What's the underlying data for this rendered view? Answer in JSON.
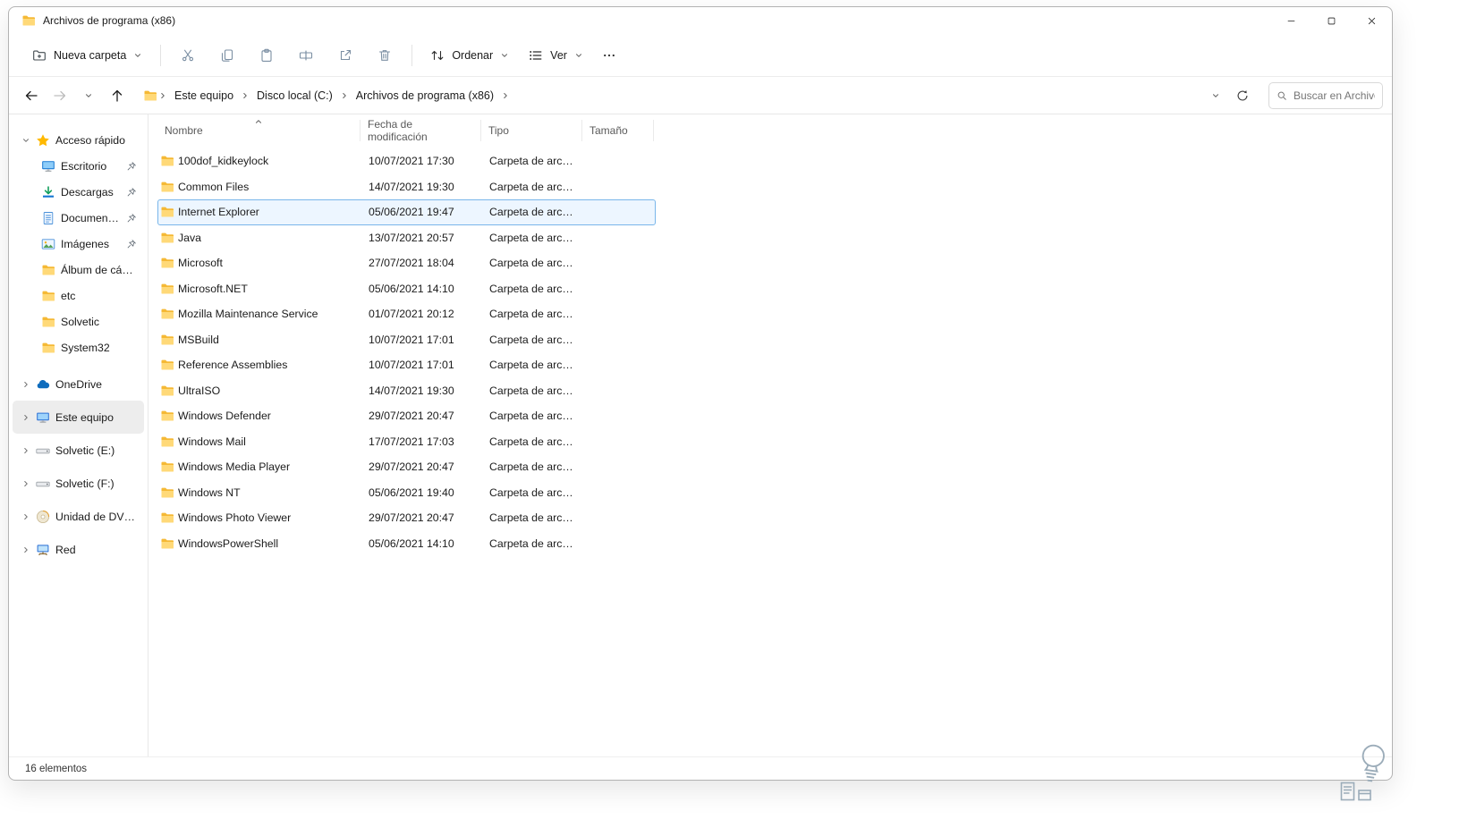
{
  "window": {
    "title": "Archivos de programa (x86)"
  },
  "colors": {
    "accent": "#0067c0",
    "selection_border": "#79b6ea",
    "selection_bg": "#edf6ff",
    "sidebar_selected_bg": "#ededed",
    "folder_yellow": "#ffca44"
  },
  "toolbar": {
    "new_folder_label": "Nueva carpeta",
    "icon_buttons": [
      "cut",
      "copy",
      "paste",
      "rename",
      "share",
      "delete"
    ],
    "sort_label": "Ordenar",
    "view_label": "Ver"
  },
  "navbar": {
    "breadcrumbs": [
      "Este equipo",
      "Disco local (C:)",
      "Archivos de programa (x86)"
    ]
  },
  "search": {
    "placeholder": "Buscar en Archivo..."
  },
  "sidebar": {
    "quick_access": {
      "label": "Acceso rápido",
      "icon": "star",
      "children": [
        {
          "label": "Escritorio",
          "icon": "desktop",
          "pinned": true
        },
        {
          "label": "Descargas",
          "icon": "download",
          "pinned": true
        },
        {
          "label": "Documentos",
          "icon": "document",
          "pinned": true
        },
        {
          "label": "Imágenes",
          "icon": "pictures",
          "pinned": true
        },
        {
          "label": "Álbum de cámara",
          "icon": "folder",
          "pinned": false
        },
        {
          "label": "etc",
          "icon": "folder",
          "pinned": false
        },
        {
          "label": "Solvetic",
          "icon": "folder",
          "pinned": false
        },
        {
          "label": "System32",
          "icon": "folder",
          "pinned": false
        }
      ]
    },
    "tree_items": [
      {
        "label": "OneDrive",
        "icon": "onedrive",
        "selected": false
      },
      {
        "label": "Este equipo",
        "icon": "computer",
        "selected": true
      },
      {
        "label": "Solvetic (E:)",
        "icon": "drive",
        "selected": false
      },
      {
        "label": "Solvetic (F:)",
        "icon": "drive",
        "selected": false
      },
      {
        "label": "Unidad de DVD (D:)",
        "icon": "dvd",
        "selected": false
      },
      {
        "label": "Red",
        "icon": "network",
        "selected": false
      }
    ]
  },
  "file_list": {
    "sort_column": "Nombre",
    "sort_direction": "asc",
    "columns": [
      {
        "label": "Nombre"
      },
      {
        "label": "Fecha de modificación"
      },
      {
        "label": "Tipo"
      },
      {
        "label": "Tamaño"
      }
    ],
    "rows": [
      {
        "name": "100dof_kidkeylock",
        "modified": "10/07/2021 17:30",
        "type": "Carpeta de archivos",
        "size": "",
        "icon": "folder",
        "selected": false
      },
      {
        "name": "Common Files",
        "modified": "14/07/2021 19:30",
        "type": "Carpeta de archivos",
        "size": "",
        "icon": "folder",
        "selected": false
      },
      {
        "name": "Internet Explorer",
        "modified": "05/06/2021 19:47",
        "type": "Carpeta de archivos",
        "size": "",
        "icon": "folder",
        "selected": true
      },
      {
        "name": "Java",
        "modified": "13/07/2021 20:57",
        "type": "Carpeta de archivos",
        "size": "",
        "icon": "folder",
        "selected": false
      },
      {
        "name": "Microsoft",
        "modified": "27/07/2021 18:04",
        "type": "Carpeta de archivos",
        "size": "",
        "icon": "folder",
        "selected": false
      },
      {
        "name": "Microsoft.NET",
        "modified": "05/06/2021 14:10",
        "type": "Carpeta de archivos",
        "size": "",
        "icon": "folder",
        "selected": false
      },
      {
        "name": "Mozilla Maintenance Service",
        "modified": "01/07/2021 20:12",
        "type": "Carpeta de archivos",
        "size": "",
        "icon": "folder",
        "selected": false
      },
      {
        "name": "MSBuild",
        "modified": "10/07/2021 17:01",
        "type": "Carpeta de archivos",
        "size": "",
        "icon": "folder",
        "selected": false
      },
      {
        "name": "Reference Assemblies",
        "modified": "10/07/2021 17:01",
        "type": "Carpeta de archivos",
        "size": "",
        "icon": "folder",
        "selected": false
      },
      {
        "name": "UltraISO",
        "modified": "14/07/2021 19:30",
        "type": "Carpeta de archivos",
        "size": "",
        "icon": "folder",
        "selected": false
      },
      {
        "name": "Windows Defender",
        "modified": "29/07/2021 20:47",
        "type": "Carpeta de archivos",
        "size": "",
        "icon": "folder",
        "selected": false
      },
      {
        "name": "Windows Mail",
        "modified": "17/07/2021 17:03",
        "type": "Carpeta de archivos",
        "size": "",
        "icon": "folder",
        "selected": false
      },
      {
        "name": "Windows Media Player",
        "modified": "29/07/2021 20:47",
        "type": "Carpeta de archivos",
        "size": "",
        "icon": "folder",
        "selected": false
      },
      {
        "name": "Windows NT",
        "modified": "05/06/2021 19:40",
        "type": "Carpeta de archivos",
        "size": "",
        "icon": "folder",
        "selected": false
      },
      {
        "name": "Windows Photo Viewer",
        "modified": "29/07/2021 20:47",
        "type": "Carpeta de archivos",
        "size": "",
        "icon": "folder",
        "selected": false
      },
      {
        "name": "WindowsPowerShell",
        "modified": "05/06/2021 14:10",
        "type": "Carpeta de archivos",
        "size": "",
        "icon": "folder",
        "selected": false
      }
    ]
  },
  "statusbar": {
    "items_count": "16 elementos"
  }
}
